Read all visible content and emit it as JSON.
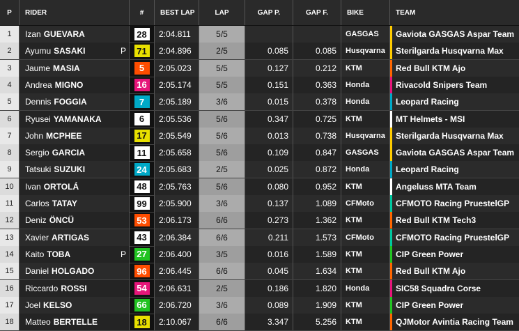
{
  "headers": {
    "pos": "P",
    "rider": "RIDER",
    "num": "#",
    "best_lap": "BEST LAP",
    "lap": "LAP",
    "gap_p": "GAP P.",
    "gap_f": "GAP F.",
    "bike": "BIKE",
    "team": "TEAM"
  },
  "rows": [
    {
      "pos": "1",
      "first": "Izan",
      "last": "GUEVARA",
      "pole": "",
      "num": "28",
      "num_bg": "#ffffff",
      "num_fg": "#111111",
      "flag": true,
      "best": "2:04.811",
      "lap": "5/5",
      "gap_p": "",
      "gap_f": "",
      "bike": "GASGAS",
      "team": "Gaviota GASGAS Aspar Team",
      "team_color": "#ffcc00"
    },
    {
      "pos": "2",
      "first": "Ayumu",
      "last": "SASAKI",
      "pole": "P",
      "num": "71",
      "num_bg": "#e8e000",
      "num_fg": "#111111",
      "flag": false,
      "best": "2:04.896",
      "lap": "2/5",
      "gap_p": "0.085",
      "gap_f": "0.085",
      "bike": "Husqvarna",
      "team": "Sterilgarda Husqvarna Max",
      "team_color": "#ffcc00"
    },
    {
      "pos": "3",
      "first": "Jaume",
      "last": "MASIA",
      "pole": "",
      "num": "5",
      "num_bg": "#ff4d00",
      "num_fg": "#ffffff",
      "flag": false,
      "best": "2:05.023",
      "lap": "5/5",
      "gap_p": "0.127",
      "gap_f": "0.212",
      "bike": "KTM",
      "team": "Red Bull KTM Ajo",
      "team_color": "#ff6600"
    },
    {
      "pos": "4",
      "first": "Andrea",
      "last": "MIGNO",
      "pole": "",
      "num": "16",
      "num_bg": "#e6157a",
      "num_fg": "#ffffff",
      "flag": false,
      "best": "2:05.174",
      "lap": "5/5",
      "gap_p": "0.151",
      "gap_f": "0.363",
      "bike": "Honda",
      "team": "Rivacold Snipers Team",
      "team_color": "#e6157a"
    },
    {
      "pos": "5",
      "first": "Dennis",
      "last": "FOGGIA",
      "pole": "",
      "num": "7",
      "num_bg": "#00a9c7",
      "num_fg": "#ffffff",
      "flag": false,
      "best": "2:05.189",
      "lap": "3/6",
      "gap_p": "0.015",
      "gap_f": "0.378",
      "bike": "Honda",
      "team": "Leopard Racing",
      "team_color": "#00a9c7"
    },
    {
      "pos": "6",
      "first": "Ryusei",
      "last": "YAMANAKA",
      "pole": "",
      "num": "6",
      "num_bg": "#ffffff",
      "num_fg": "#111111",
      "flag": false,
      "best": "2:05.536",
      "lap": "5/6",
      "gap_p": "0.347",
      "gap_f": "0.725",
      "bike": "KTM",
      "team": "MT Helmets - MSI",
      "team_color": "#ffffff"
    },
    {
      "pos": "7",
      "first": "John",
      "last": "MCPHEE",
      "pole": "",
      "num": "17",
      "num_bg": "#e8e000",
      "num_fg": "#111111",
      "flag": false,
      "best": "2:05.549",
      "lap": "5/6",
      "gap_p": "0.013",
      "gap_f": "0.738",
      "bike": "Husqvarna",
      "team": "Sterilgarda Husqvarna Max",
      "team_color": "#ffcc00"
    },
    {
      "pos": "8",
      "first": "Sergio",
      "last": "GARCIA",
      "pole": "",
      "num": "11",
      "num_bg": "#ffffff",
      "num_fg": "#111111",
      "flag": false,
      "best": "2:05.658",
      "lap": "5/6",
      "gap_p": "0.109",
      "gap_f": "0.847",
      "bike": "GASGAS",
      "team": "Gaviota GASGAS Aspar Team",
      "team_color": "#ffcc00"
    },
    {
      "pos": "9",
      "first": "Tatsuki",
      "last": "SUZUKI",
      "pole": "",
      "num": "24",
      "num_bg": "#00a9c7",
      "num_fg": "#ffffff",
      "flag": false,
      "best": "2:05.683",
      "lap": "2/5",
      "gap_p": "0.025",
      "gap_f": "0.872",
      "bike": "Honda",
      "team": "Leopard Racing",
      "team_color": "#00a9c7"
    },
    {
      "pos": "10",
      "first": "Ivan",
      "last": "ORTOLÁ",
      "pole": "",
      "num": "48",
      "num_bg": "#ffffff",
      "num_fg": "#111111",
      "flag": false,
      "best": "2:05.763",
      "lap": "5/6",
      "gap_p": "0.080",
      "gap_f": "0.952",
      "bike": "KTM",
      "team": "Angeluss MTA Team",
      "team_color": "#ffffff"
    },
    {
      "pos": "11",
      "first": "Carlos",
      "last": "TATAY",
      "pole": "",
      "num": "99",
      "num_bg": "#ffffff",
      "num_fg": "#111111",
      "flag": false,
      "best": "2:05.900",
      "lap": "3/6",
      "gap_p": "0.137",
      "gap_f": "1.089",
      "bike": "CFMoto",
      "team": "CFMOTO Racing PruestelGP",
      "team_color": "#00c8a0"
    },
    {
      "pos": "12",
      "first": "Deniz",
      "last": "ÖNCÜ",
      "pole": "",
      "num": "53",
      "num_bg": "#ff4d00",
      "num_fg": "#ffffff",
      "flag": false,
      "best": "2:06.173",
      "lap": "6/6",
      "gap_p": "0.273",
      "gap_f": "1.362",
      "bike": "KTM",
      "team": "Red Bull KTM Tech3",
      "team_color": "#ff6600"
    },
    {
      "pos": "13",
      "first": "Xavier",
      "last": "ARTIGAS",
      "pole": "",
      "num": "43",
      "num_bg": "#ffffff",
      "num_fg": "#111111",
      "flag": false,
      "best": "2:06.384",
      "lap": "6/6",
      "gap_p": "0.211",
      "gap_f": "1.573",
      "bike": "CFMoto",
      "team": "CFMOTO Racing PruestelGP",
      "team_color": "#00c8a0"
    },
    {
      "pos": "14",
      "first": "Kaito",
      "last": "TOBA",
      "pole": "P",
      "num": "27",
      "num_bg": "#22c322",
      "num_fg": "#ffffff",
      "flag": false,
      "best": "2:06.400",
      "lap": "3/5",
      "gap_p": "0.016",
      "gap_f": "1.589",
      "bike": "KTM",
      "team": "CIP Green Power",
      "team_color": "#22c322"
    },
    {
      "pos": "15",
      "first": "Daniel",
      "last": "HOLGADO",
      "pole": "",
      "num": "96",
      "num_bg": "#ff4d00",
      "num_fg": "#ffffff",
      "flag": false,
      "best": "2:06.445",
      "lap": "6/6",
      "gap_p": "0.045",
      "gap_f": "1.634",
      "bike": "KTM",
      "team": "Red Bull KTM Ajo",
      "team_color": "#ff6600"
    },
    {
      "pos": "16",
      "first": "Riccardo",
      "last": "ROSSI",
      "pole": "",
      "num": "54",
      "num_bg": "#e6157a",
      "num_fg": "#ffffff",
      "flag": false,
      "best": "2:06.631",
      "lap": "2/5",
      "gap_p": "0.186",
      "gap_f": "1.820",
      "bike": "Honda",
      "team": "SIC58 Squadra Corse",
      "team_color": "#e6157a"
    },
    {
      "pos": "17",
      "first": "Joel",
      "last": "KELSO",
      "pole": "",
      "num": "66",
      "num_bg": "#22c322",
      "num_fg": "#ffffff",
      "flag": false,
      "best": "2:06.720",
      "lap": "3/6",
      "gap_p": "0.089",
      "gap_f": "1.909",
      "bike": "KTM",
      "team": "CIP Green Power",
      "team_color": "#22c322"
    },
    {
      "pos": "18",
      "first": "Matteo",
      "last": "BERTELLE",
      "pole": "",
      "num": "18",
      "num_bg": "#e8e000",
      "num_fg": "#111111",
      "flag": false,
      "best": "2:10.067",
      "lap": "6/6",
      "gap_p": "3.347",
      "gap_f": "5.256",
      "bike": "KTM",
      "team": "QJMotor Avintia Racing Team",
      "team_color": "#ff6600"
    }
  ]
}
